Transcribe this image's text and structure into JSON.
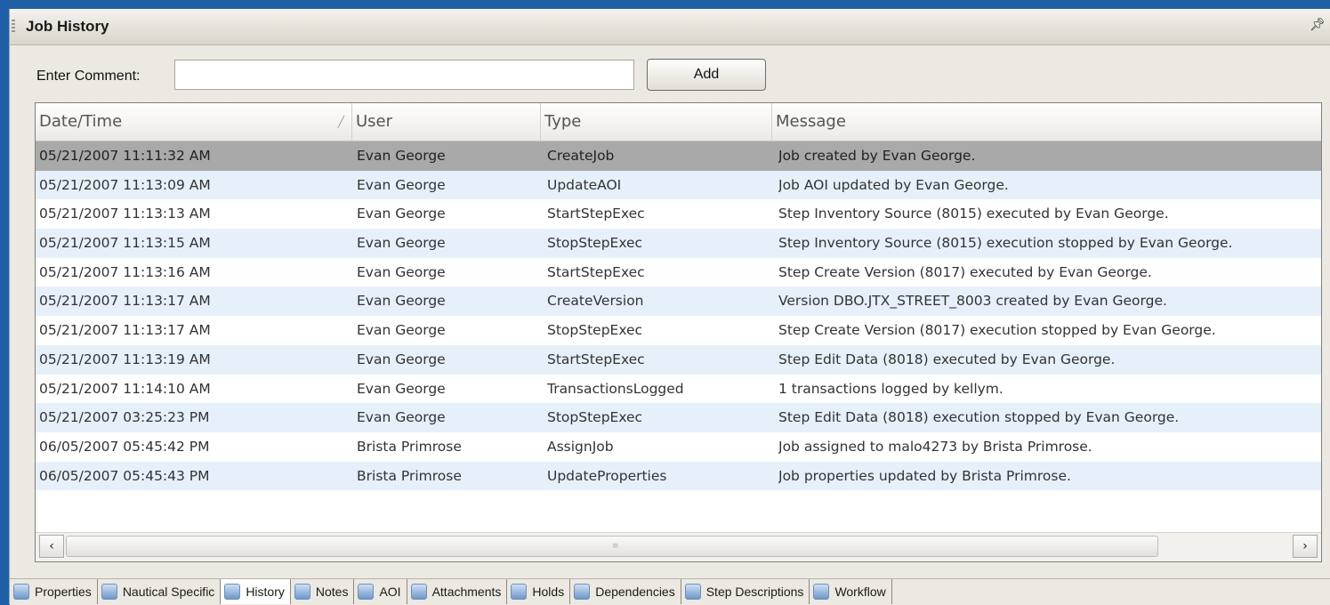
{
  "panel": {
    "title": "Job History"
  },
  "comment": {
    "label": "Enter Comment:",
    "value": "",
    "add_label": "Add"
  },
  "table": {
    "columns": [
      "Date/Time",
      "User",
      "Type",
      "Message"
    ],
    "rows": [
      {
        "datetime": "05/21/2007 11:11:32 AM",
        "user": "Evan George",
        "type": "CreateJob",
        "message": "Job created by Evan George."
      },
      {
        "datetime": "05/21/2007 11:13:09 AM",
        "user": "Evan George",
        "type": "UpdateAOI",
        "message": "Job AOI updated by Evan George."
      },
      {
        "datetime": "05/21/2007 11:13:13 AM",
        "user": "Evan George",
        "type": "StartStepExec",
        "message": "Step Inventory Source (8015) executed by Evan George."
      },
      {
        "datetime": "05/21/2007 11:13:15 AM",
        "user": "Evan George",
        "type": "StopStepExec",
        "message": "Step Inventory Source (8015) execution stopped by Evan George."
      },
      {
        "datetime": "05/21/2007 11:13:16 AM",
        "user": "Evan George",
        "type": "StartStepExec",
        "message": "Step Create Version (8017) executed by Evan George."
      },
      {
        "datetime": "05/21/2007 11:13:17 AM",
        "user": "Evan George",
        "type": "CreateVersion",
        "message": "Version DBO.JTX_STREET_8003 created by Evan George."
      },
      {
        "datetime": "05/21/2007 11:13:17 AM",
        "user": "Evan George",
        "type": "StopStepExec",
        "message": "Step Create Version (8017) execution stopped by Evan George."
      },
      {
        "datetime": "05/21/2007 11:13:19 AM",
        "user": "Evan George",
        "type": "StartStepExec",
        "message": "Step Edit Data (8018) executed by Evan George."
      },
      {
        "datetime": "05/21/2007 11:14:10 AM",
        "user": "Evan George",
        "type": "TransactionsLogged",
        "message": "1 transactions logged by kellym."
      },
      {
        "datetime": "05/21/2007 03:25:23 PM",
        "user": "Evan George",
        "type": "StopStepExec",
        "message": "Step Edit Data (8018) execution stopped by Evan George."
      },
      {
        "datetime": "06/05/2007 05:45:42 PM",
        "user": "Brista Primrose",
        "type": "AssignJob",
        "message": "Job assigned to malo4273 by Brista Primrose."
      },
      {
        "datetime": "06/05/2007 05:45:43 PM",
        "user": "Brista Primrose",
        "type": "UpdateProperties",
        "message": "Job properties updated by Brista Primrose."
      }
    ],
    "selected_row": 0
  },
  "tabs": [
    {
      "label": "Properties",
      "icon": "properties-icon"
    },
    {
      "label": "Nautical Specific",
      "icon": "nautical-icon"
    },
    {
      "label": "History",
      "icon": "history-icon",
      "active": true
    },
    {
      "label": "Notes",
      "icon": "notes-icon"
    },
    {
      "label": "AOI",
      "icon": "aoi-icon"
    },
    {
      "label": "Attachments",
      "icon": "attachments-icon"
    },
    {
      "label": "Holds",
      "icon": "holds-icon"
    },
    {
      "label": "Dependencies",
      "icon": "dependencies-icon"
    },
    {
      "label": "Step Descriptions",
      "icon": "step-descriptions-icon"
    },
    {
      "label": "Workflow",
      "icon": "workflow-icon"
    }
  ]
}
